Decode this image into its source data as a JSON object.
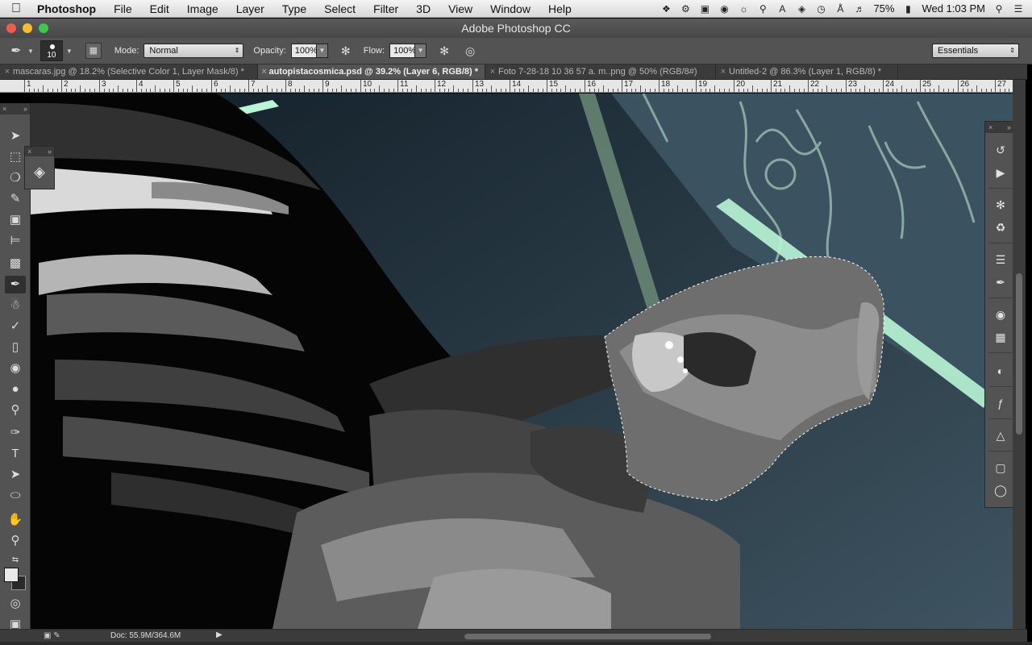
{
  "menubar": {
    "app_name": "Photoshop",
    "items": [
      "File",
      "Edit",
      "Image",
      "Layer",
      "Type",
      "Select",
      "Filter",
      "3D",
      "View",
      "Window",
      "Help"
    ],
    "battery": "75%",
    "clock": "Wed 1:03 PM"
  },
  "window": {
    "title": "Adobe Photoshop CC"
  },
  "options": {
    "brush_size": "10",
    "mode_label": "Mode:",
    "mode_value": "Normal",
    "opacity_label": "Opacity:",
    "opacity_value": "100%",
    "flow_label": "Flow:",
    "flow_value": "100%",
    "workspace": "Essentials"
  },
  "tabs": [
    {
      "label": "mascaras.jpg @ 18.2% (Selective Color 1, Layer Mask/8) *",
      "active": false
    },
    {
      "label": "autopistacosmica.psd @ 39.2% (Layer 6, RGB/8) *",
      "active": true
    },
    {
      "label": "Foto 7-28-18 10 36 57 a. m..png @ 50% (RGB/8#)",
      "active": false
    },
    {
      "label": "Untitled-2 @ 86.3% (Layer 1, RGB/8) *",
      "active": false
    }
  ],
  "ruler": {
    "labels": [
      "1",
      "2",
      "3",
      "4",
      "5",
      "6",
      "7",
      "8",
      "9",
      "10",
      "11",
      "12",
      "13",
      "14",
      "15",
      "16",
      "17",
      "18",
      "19",
      "20",
      "21",
      "22",
      "23",
      "24",
      "25",
      "26",
      "27"
    ]
  },
  "status": {
    "doc_info": "Doc: 55.9M/364.6M"
  },
  "colors": {
    "accent_green": "#b9f5d6",
    "ui_panel": "#535353",
    "foreground": "#e8e8e8",
    "background": "#2a2a2a"
  }
}
